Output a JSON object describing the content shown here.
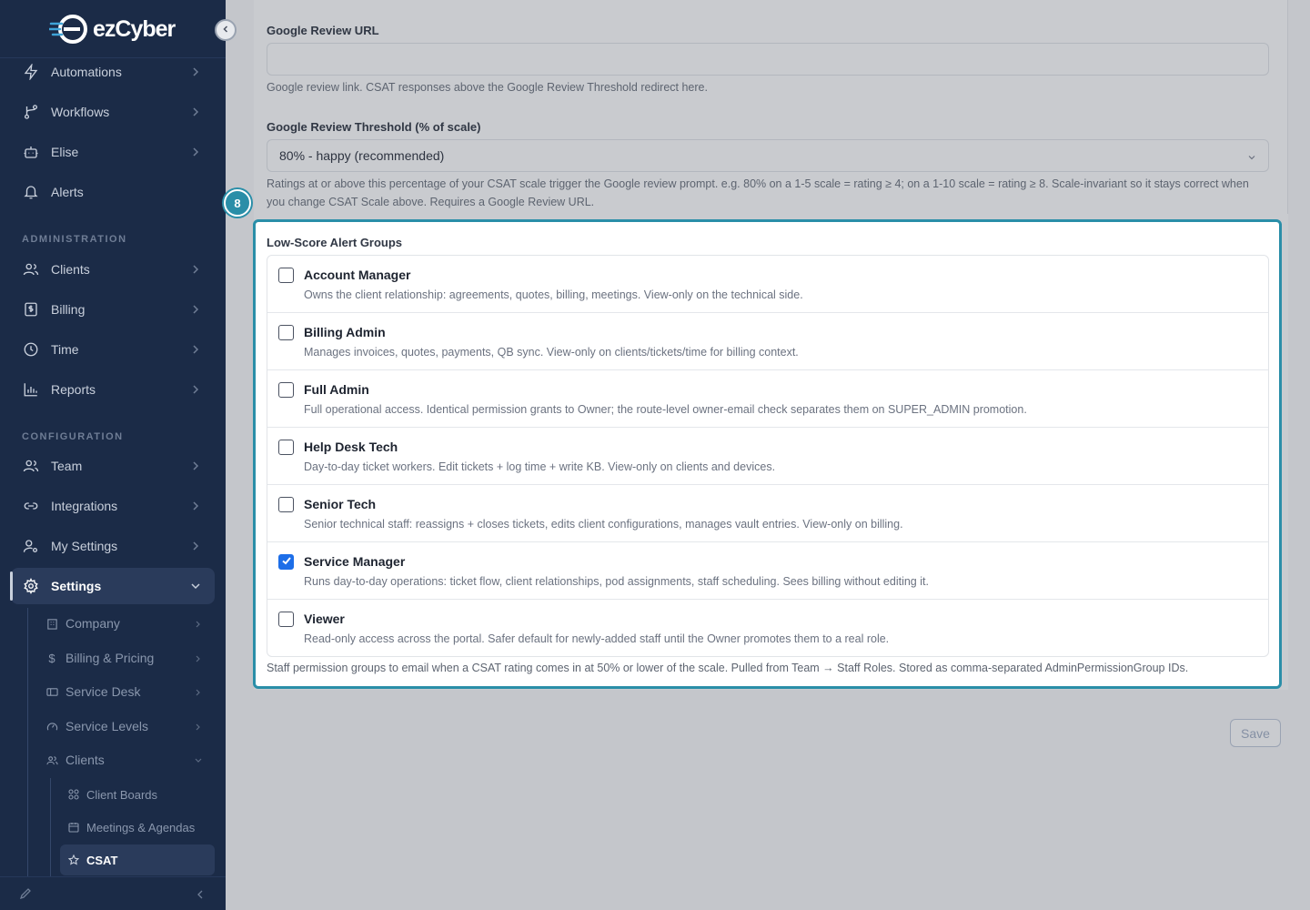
{
  "app": {
    "name": "ezCyber"
  },
  "sidebar": {
    "items_top": [
      {
        "label": "Automations",
        "icon": "lightning-icon"
      },
      {
        "label": "Workflows",
        "icon": "branch-icon"
      },
      {
        "label": "Elise",
        "icon": "robot-icon"
      },
      {
        "label": "Alerts",
        "icon": "bell-icon"
      }
    ],
    "section_admin": "ADMINISTRATION",
    "items_admin": [
      {
        "label": "Clients",
        "icon": "users-icon"
      },
      {
        "label": "Billing",
        "icon": "dollar-icon"
      },
      {
        "label": "Time",
        "icon": "clock-icon"
      },
      {
        "label": "Reports",
        "icon": "chart-icon"
      }
    ],
    "section_config": "CONFIGURATION",
    "items_config": [
      {
        "label": "Team",
        "icon": "users-icon"
      },
      {
        "label": "Integrations",
        "icon": "link-icon"
      },
      {
        "label": "My Settings",
        "icon": "user-gear-icon"
      },
      {
        "label": "Settings",
        "icon": "gear-icon"
      }
    ],
    "settings_sub": [
      {
        "label": "Company"
      },
      {
        "label": "Billing & Pricing"
      },
      {
        "label": "Service Desk"
      },
      {
        "label": "Service Levels"
      },
      {
        "label": "Clients"
      }
    ],
    "clients_sub": [
      {
        "label": "Client Boards"
      },
      {
        "label": "Meetings & Agendas"
      },
      {
        "label": "CSAT"
      }
    ]
  },
  "form": {
    "google_url": {
      "label": "Google Review URL",
      "value": "",
      "help": "Google review link. CSAT responses above the Google Review Threshold redirect here."
    },
    "threshold": {
      "label": "Google Review Threshold (% of scale)",
      "value": "80% - happy (recommended)",
      "help": "Ratings at or above this percentage of your CSAT scale trigger the Google review prompt. e.g. 80% on a 1-5 scale = rating ≥ 4; on a 1-10 scale = rating ≥ 8. Scale-invariant so it stays correct when you change CSAT Scale above. Requires a Google Review URL."
    },
    "step_badge": "8",
    "alert_groups": {
      "label": "Low-Score Alert Groups",
      "groups": [
        {
          "name": "Account Manager",
          "checked": false,
          "desc": "Owns the client relationship: agreements, quotes, billing, meetings. View-only on the technical side."
        },
        {
          "name": "Billing Admin",
          "checked": false,
          "desc": "Manages invoices, quotes, payments, QB sync. View-only on clients/tickets/time for billing context."
        },
        {
          "name": "Full Admin",
          "checked": false,
          "desc": "Full operational access. Identical permission grants to Owner; the route-level owner-email check separates them on SUPER_ADMIN promotion."
        },
        {
          "name": "Help Desk Tech",
          "checked": false,
          "desc": "Day-to-day ticket workers. Edit tickets + log time + write KB. View-only on clients and devices."
        },
        {
          "name": "Senior Tech",
          "checked": false,
          "desc": "Senior technical staff: reassigns + closes tickets, edits client configurations, manages vault entries. View-only on billing."
        },
        {
          "name": "Service Manager",
          "checked": true,
          "desc": "Runs day-to-day operations: ticket flow, client relationships, pod assignments, staff scheduling. Sees billing without editing it."
        },
        {
          "name": "Viewer",
          "checked": false,
          "desc": "Read-only access across the portal. Safer default for newly-added staff until the Owner promotes them to a real role."
        }
      ],
      "help": "Staff permission groups to email when a CSAT rating comes in at 50% or lower of the scale. Pulled from Team → Staff Roles. Stored as comma-separated AdminPermissionGroup IDs."
    },
    "save_label": "Save"
  }
}
